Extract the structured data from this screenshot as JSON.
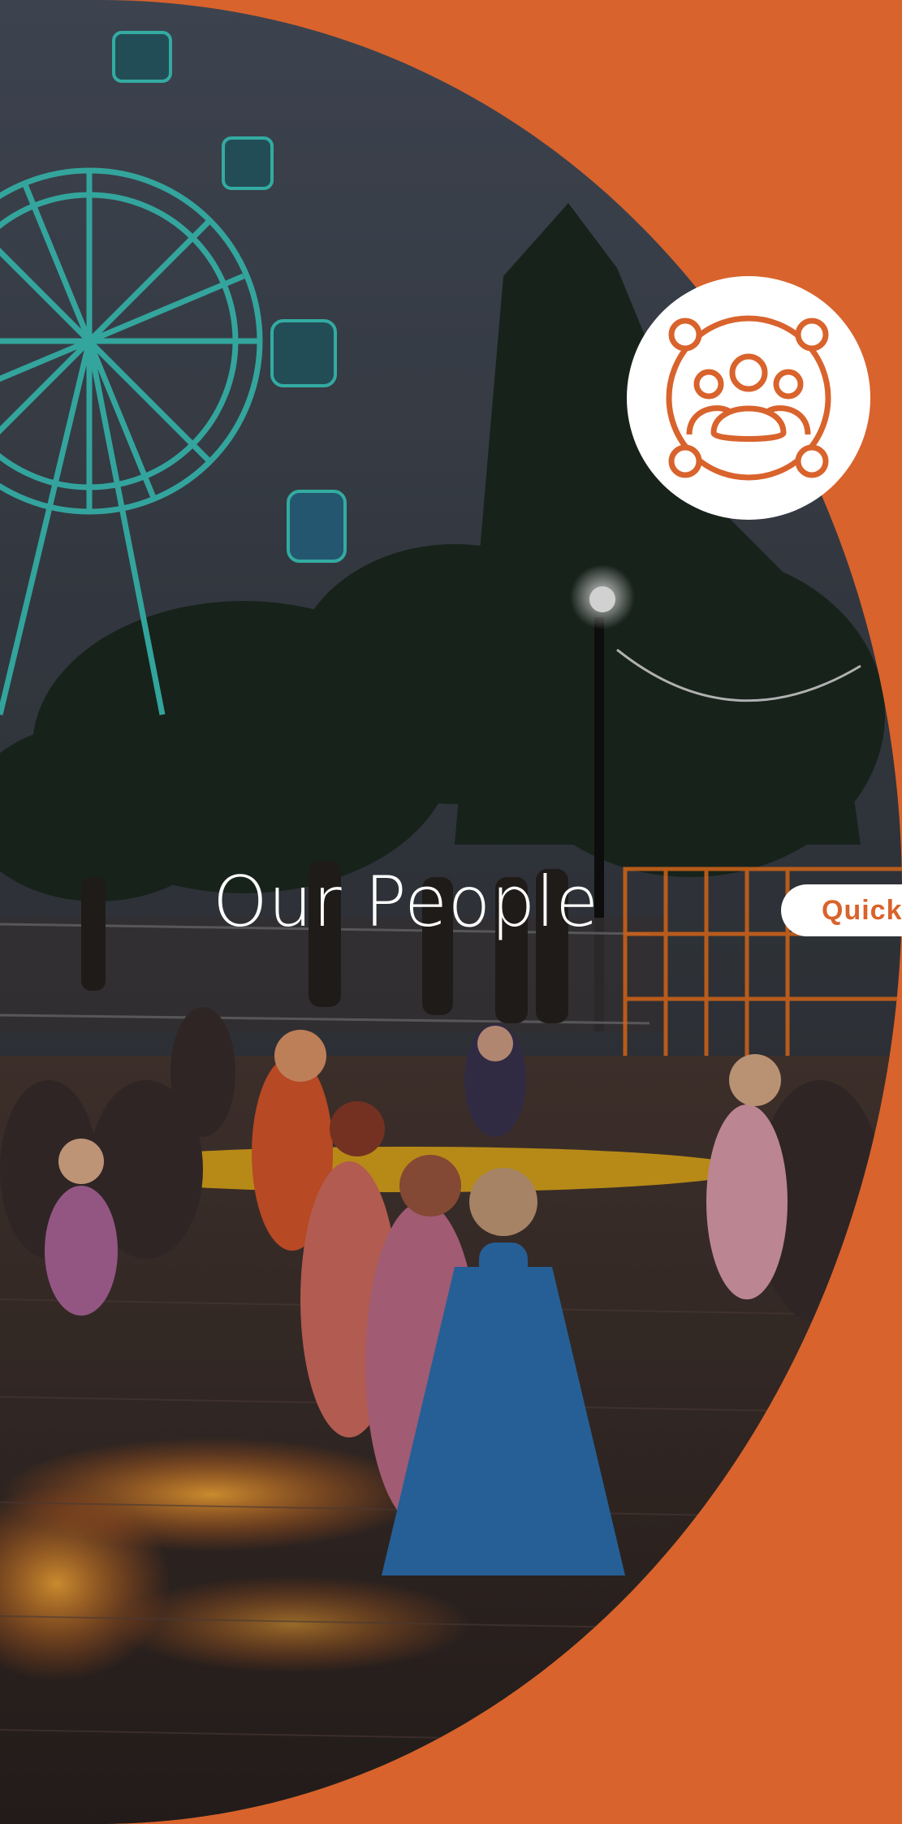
{
  "page": {
    "title": "Our People",
    "quick_link_label": "Quick",
    "badge_icon": "community-group-icon",
    "hero_image": "night-carnival-with-ferris-wheel-and-children-dancing",
    "colors": {
      "brand_orange": "#D9632C",
      "white": "#FFFFFF"
    }
  }
}
